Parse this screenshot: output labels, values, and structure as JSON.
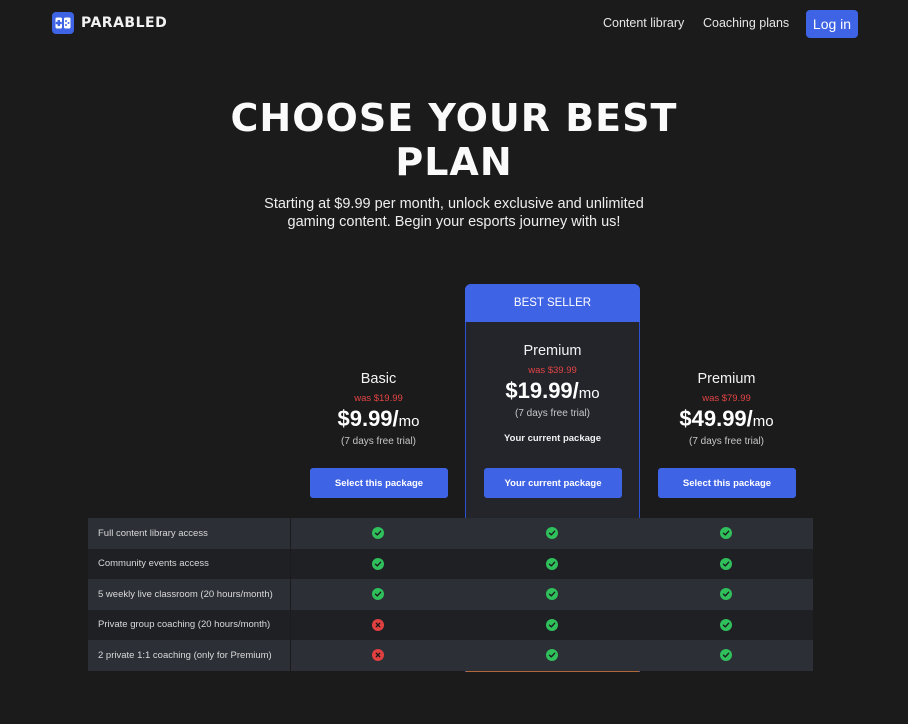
{
  "nav": {
    "brand": "PARABLED",
    "links": [
      "Content library",
      "Coaching plans"
    ],
    "login": "Log in"
  },
  "hero": {
    "title_line1": "CHOOSE YOUR BEST",
    "title_line2": "PLAN",
    "subtitle": "Starting at $9.99 per month, unlock exclusive and unlimited gaming content. Begin your esports journey with us!"
  },
  "highlight_label": "BEST SELLER",
  "plans": [
    {
      "name": "Basic",
      "was": "was $19.99",
      "price": "$9.99/",
      "unit": "mo",
      "trial": "(7 days free trial)",
      "current": "",
      "button": "Select this package"
    },
    {
      "name": "Premium",
      "was": "was $39.99",
      "price": "$19.99/",
      "unit": "mo",
      "trial": "(7 days free trial)",
      "current": "Your current package",
      "button": "Your current package"
    },
    {
      "name": "Premium",
      "was": "was $79.99",
      "price": "$49.99/",
      "unit": "mo",
      "trial": "(7 days free trial)",
      "current": "",
      "button": "Select this package"
    }
  ],
  "features": [
    {
      "label": "Full content library access",
      "values": [
        true,
        true,
        true
      ]
    },
    {
      "label": "Community events access",
      "values": [
        true,
        true,
        true
      ]
    },
    {
      "label": "5 weekly live classroom (20 hours/month)",
      "values": [
        true,
        true,
        true
      ]
    },
    {
      "label": "Private group coaching (20 hours/month)",
      "values": [
        false,
        true,
        true
      ]
    },
    {
      "label": "2 private 1:1 coaching  (only for Premium)",
      "values": [
        false,
        true,
        true
      ]
    }
  ],
  "icons": {
    "included": "check-circle-icon",
    "excluded": "x-circle-icon"
  },
  "colors": {
    "accent": "#3f63e5",
    "background": "#1b1b1c",
    "strike_price": "#e34444",
    "ok": "#2fbf5b",
    "no": "#e24040"
  }
}
